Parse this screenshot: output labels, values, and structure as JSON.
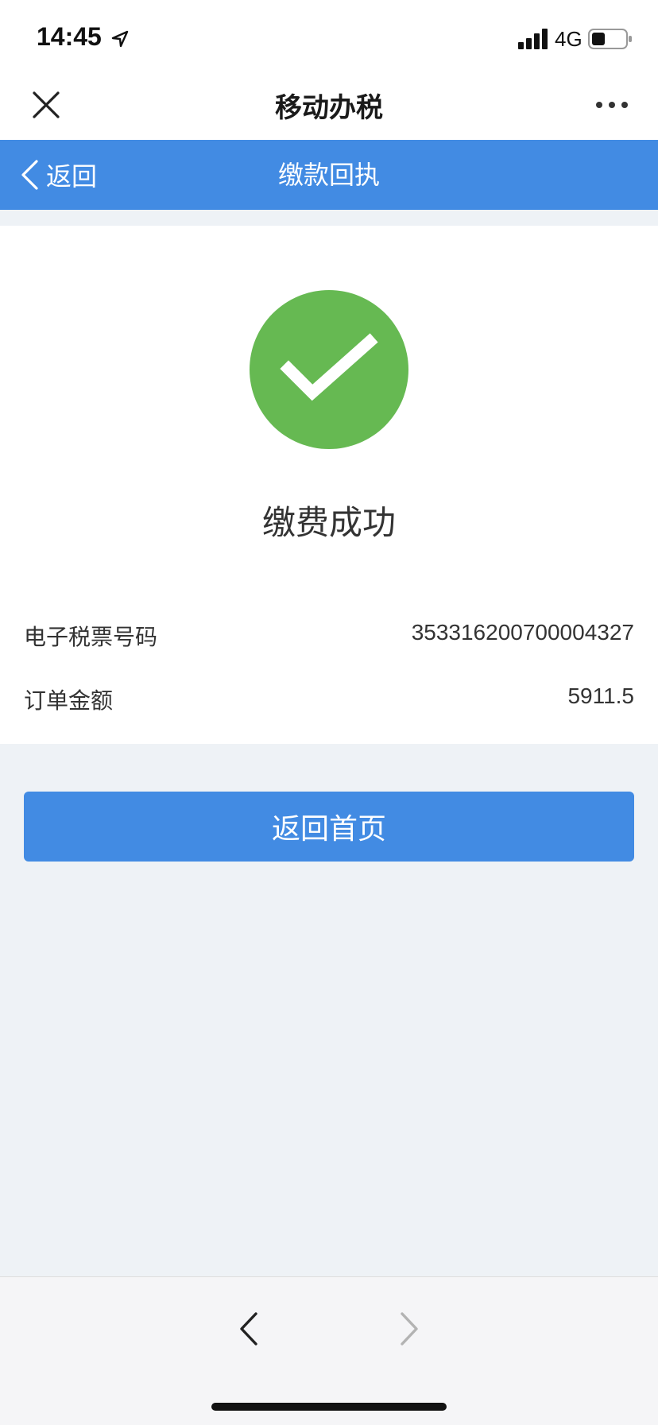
{
  "status_bar": {
    "time": "14:45",
    "network": "4G",
    "icons": [
      "location-arrow-icon",
      "signal-icon",
      "battery-icon"
    ]
  },
  "wechat_bar": {
    "title": "移动办税",
    "close_icon": "close-icon",
    "more_icon": "more-icon"
  },
  "app_header": {
    "back_label": "返回",
    "title": "缴款回执",
    "background_color": "#428be3"
  },
  "result": {
    "icon": "check-circle-icon",
    "icon_color": "#66b952",
    "title": "缴费成功",
    "fields": [
      {
        "label": "电子税票号码",
        "value": "353316200700004327"
      },
      {
        "label": "订单金额",
        "value": "5911.5"
      }
    ]
  },
  "actions": {
    "home_button_label": "返回首页"
  },
  "browser_nav": {
    "back_icon": "chevron-left-icon",
    "forward_icon": "chevron-right-icon"
  }
}
